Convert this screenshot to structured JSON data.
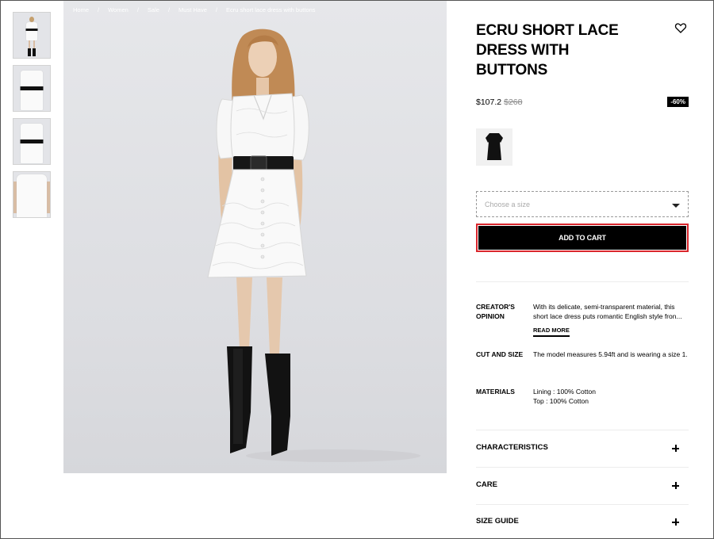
{
  "breadcrumb": {
    "items": [
      "Home",
      "Women",
      "Sale",
      "Must Have",
      "Ecru short lace dress with buttons"
    ],
    "separator": "/"
  },
  "product": {
    "title": "ECRU SHORT LACE DRESS WITH BUTTONS",
    "price": "$107.2",
    "old_price": "$268",
    "discount": "-60%",
    "wishlist_icon": "heart-icon",
    "color_swatch_color": "#111111"
  },
  "size_select": {
    "placeholder": "Choose a size",
    "icon": "chevron-down-icon"
  },
  "cart": {
    "button_label": "ADD TO CART",
    "highlight_color": "#d9262c"
  },
  "details": {
    "creator_label": "CREATOR'S OPINION",
    "creator_text": "With its delicate, semi-transparent material, this short lace dress puts romantic English style fron...",
    "read_more": "READ MORE",
    "cut_label": "CUT AND SIZE",
    "cut_text": "The model measures 5.94ft and is wearing a size 1.",
    "materials_label": "MATERIALS",
    "materials_line1": "Lining : 100% Cotton",
    "materials_line2": "Top : 100% Cotton"
  },
  "accordions": {
    "characteristics": "CHARACTERISTICS",
    "care": "CARE",
    "size_guide": "SIZE GUIDE",
    "icon": "plus-icon"
  },
  "colors": {
    "background": "#ffffff",
    "text": "#000000",
    "photo_bg": "#dfe0e4"
  }
}
